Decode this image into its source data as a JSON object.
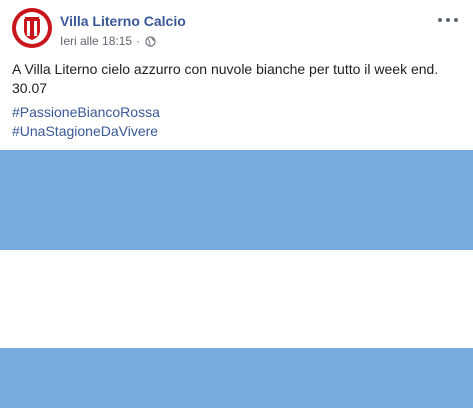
{
  "post": {
    "author": "Villa Literno Calcio",
    "timestamp": "Ieri alle 18:15",
    "separator": "·",
    "privacy_icon": "globe-icon",
    "menu_icon": "more-options-icon",
    "message_line1": "A Villa Literno cielo azzurro con nuvole bianche per tutto il week end.",
    "message_line2": "30.07",
    "hashtags": [
      "#PassioneBiancoRossa",
      "#UnaStagioneDaVivere"
    ]
  },
  "photo": {
    "description_colors": {
      "sky_blue": "#77aadd",
      "white": "#ffffff"
    }
  },
  "colors": {
    "link": "#385898",
    "meta": "#616770",
    "text": "#1c1e21",
    "crest_red": "#c8161d"
  }
}
